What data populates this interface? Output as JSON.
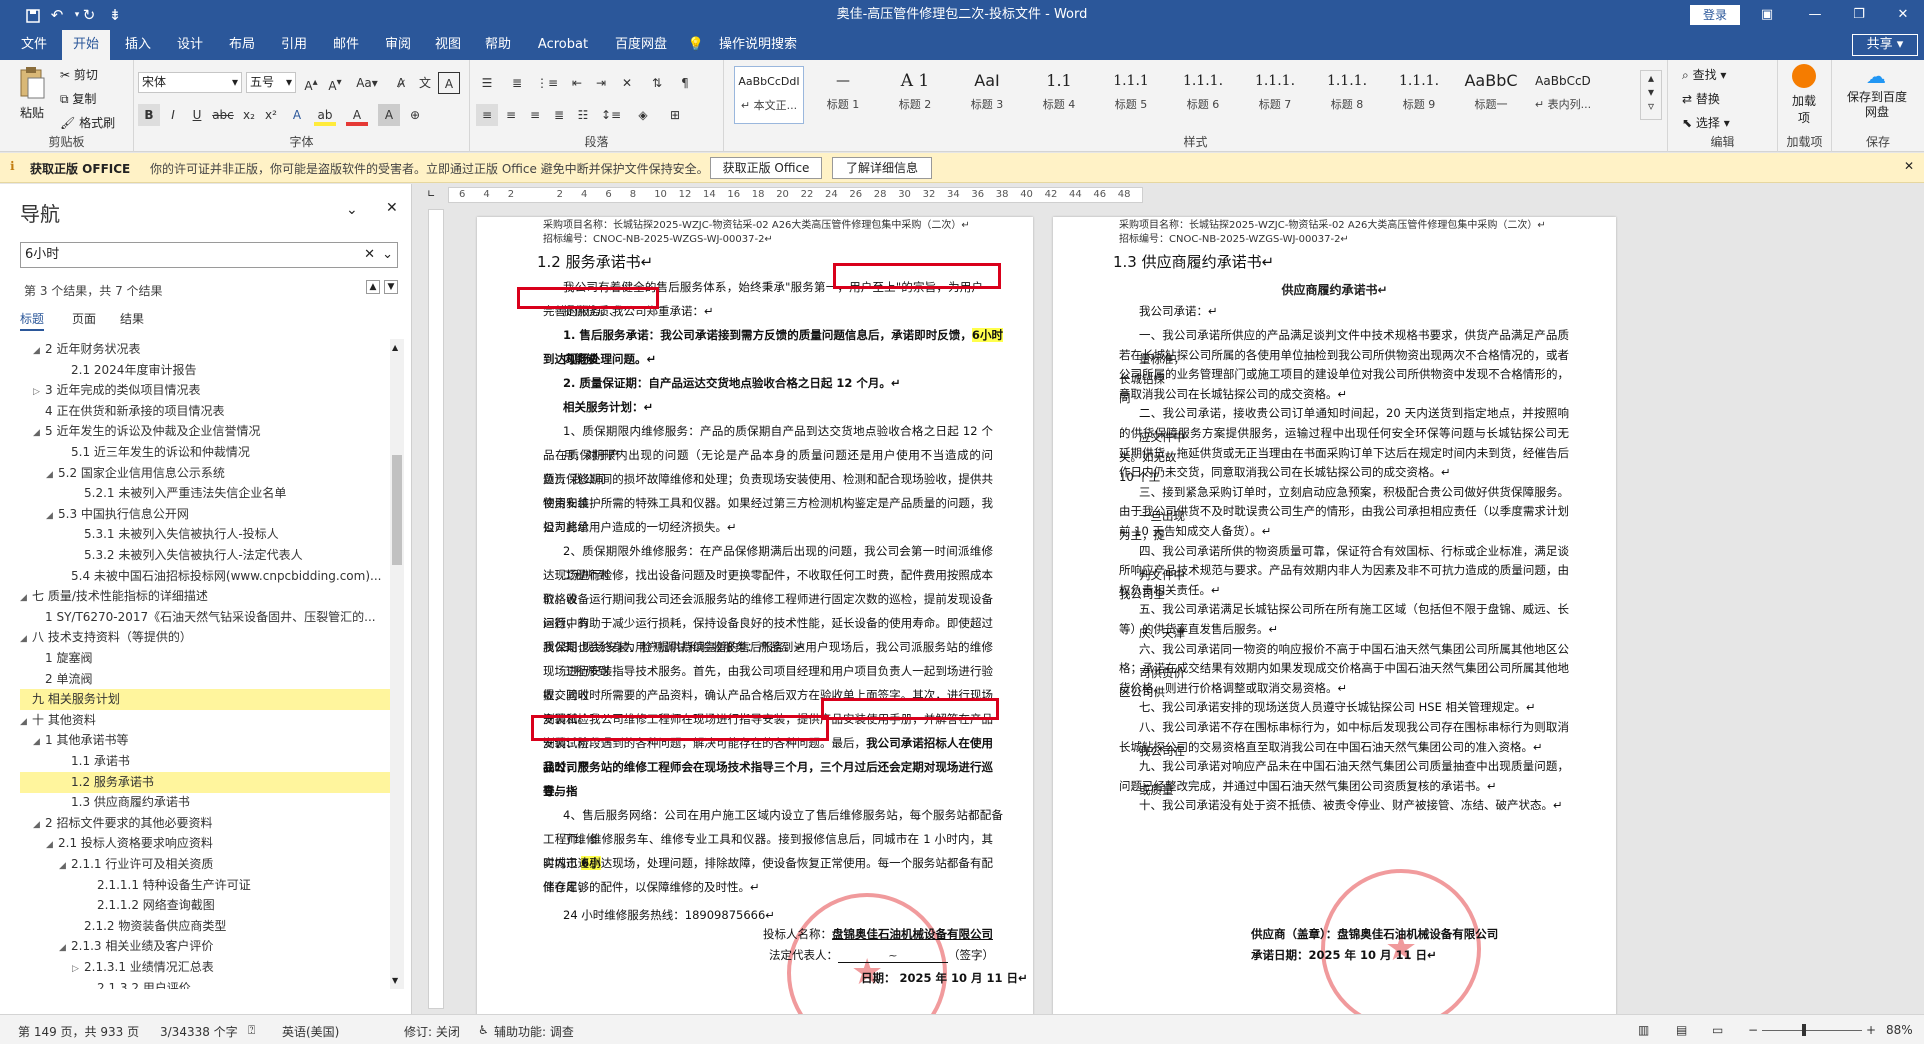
{
  "titlebar": {
    "title": "奥佳-高压管件修理包二次-投标文件 - Word",
    "login": "登录"
  },
  "menu": {
    "tabs": [
      "文件",
      "开始",
      "插入",
      "设计",
      "布局",
      "引用",
      "邮件",
      "审阅",
      "视图",
      "帮助",
      "Acrobat",
      "百度网盘",
      "操作说明搜索"
    ],
    "share": "共享"
  },
  "ribbon": {
    "clipboard": {
      "paste": "粘贴",
      "cut": "剪切",
      "copy": "复制",
      "format_painter": "格式刷",
      "label": "剪贴板"
    },
    "font": {
      "name": "宋体",
      "size": "五号",
      "label": "字体"
    },
    "paragraph": {
      "label": "段落"
    },
    "styles": {
      "label": "样式",
      "items": [
        {
          "preview": "AaBbCcDdI",
          "name": "↵ 本文正..."
        },
        {
          "preview": "—",
          "name": "标题 1"
        },
        {
          "preview": "A 1",
          "name": "标题 2"
        },
        {
          "preview": "AaI",
          "name": "标题 3"
        },
        {
          "preview": "1.1",
          "name": "标题 4"
        },
        {
          "preview": "1.1.1",
          "name": "标题 5"
        },
        {
          "preview": "1.1.1.",
          "name": "标题 6"
        },
        {
          "preview": "1.1.1.",
          "name": "标题 7"
        },
        {
          "preview": "1.1.1.",
          "name": "标题 8"
        },
        {
          "preview": "1.1.1.",
          "name": "标题 9"
        },
        {
          "preview": "AaBbC",
          "name": "标题一"
        },
        {
          "preview": "AaBbCcD",
          "name": "↵ 表内列..."
        }
      ]
    },
    "editing": {
      "find": "查找",
      "replace": "替换",
      "select": "选择",
      "label": "编辑"
    },
    "addins": {
      "load": "加载项",
      "label": "加载项"
    },
    "save": {
      "baidu": "保存到百度网盘",
      "label": "保存"
    }
  },
  "notice": {
    "title": "获取正版 OFFICE",
    "text": "你的许可证并非正版，你可能是盗版软件的受害者。立即通过正版 Office 避免中断并保护文件保持安全。",
    "btn1": "获取正版 Office",
    "btn2": "了解详细信息"
  },
  "nav": {
    "title": "导航",
    "search": "6小时",
    "result": "第 3 个结果，共 7 个结果",
    "tabs": [
      "标题",
      "页面",
      "结果"
    ],
    "items": [
      {
        "text": "2 近年财务状况表",
        "indent": 1,
        "tri": "◢"
      },
      {
        "text": "2.1 2024年度审计报告",
        "indent": 3,
        "tri": ""
      },
      {
        "text": "3 近年完成的类似项目情况表",
        "indent": 1,
        "tri": "▷"
      },
      {
        "text": "4 正在供货和新承接的项目情况表",
        "indent": 1,
        "tri": ""
      },
      {
        "text": "5 近年发生的诉讼及仲裁及企业信誉情况",
        "indent": 1,
        "tri": "◢"
      },
      {
        "text": "5.1 近三年发生的诉讼和仲裁情况",
        "indent": 3,
        "tri": ""
      },
      {
        "text": "5.2 国家企业信用信息公示系统",
        "indent": 2,
        "tri": "◢"
      },
      {
        "text": "5.2.1 未被列入严重违法失信企业名单",
        "indent": 4,
        "tri": ""
      },
      {
        "text": "5.3 中国执行信息公开网",
        "indent": 2,
        "tri": "◢"
      },
      {
        "text": "5.3.1 未被列入失信被执行人-投标人",
        "indent": 4,
        "tri": ""
      },
      {
        "text": "5.3.2 未被列入失信被执行人-法定代表人",
        "indent": 4,
        "tri": ""
      },
      {
        "text": "5.4 未被中国石油招标投标网(www.cnpcbidding.com)...",
        "indent": 3,
        "tri": ""
      },
      {
        "text": "七 质量/技术性能指标的详细描述",
        "indent": 0,
        "tri": "◢"
      },
      {
        "text": "1 SY/T6270-2017《石油天然气钻采设备固井、压裂管汇的...",
        "indent": 1,
        "tri": ""
      },
      {
        "text": "八 技术支持资料（等提供的）",
        "indent": 0,
        "tri": "◢"
      },
      {
        "text": "1 旋塞阀",
        "indent": 1,
        "tri": ""
      },
      {
        "text": "2 单流阀",
        "indent": 1,
        "tri": ""
      },
      {
        "text": "九 相关服务计划",
        "indent": 0,
        "tri": "",
        "hl": true
      },
      {
        "text": "十 其他资料",
        "indent": 0,
        "tri": "◢"
      },
      {
        "text": "1 其他承诺书等",
        "indent": 1,
        "tri": "◢"
      },
      {
        "text": "1.1 承诺书",
        "indent": 3,
        "tri": ""
      },
      {
        "text": "1.2 服务承诺书",
        "indent": 3,
        "tri": "",
        "hl": true
      },
      {
        "text": "1.3 供应商履约承诺书",
        "indent": 3,
        "tri": ""
      },
      {
        "text": "2 招标文件要求的其他必要资料",
        "indent": 1,
        "tri": "◢"
      },
      {
        "text": "2.1 投标人资格要求响应资料",
        "indent": 2,
        "tri": "◢"
      },
      {
        "text": "2.1.1 行业许可及相关资质",
        "indent": 3,
        "tri": "◢"
      },
      {
        "text": "2.1.1.1 特种设备生产许可证",
        "indent": 5,
        "tri": ""
      },
      {
        "text": "2.1.1.2 网络查询截图",
        "indent": 5,
        "tri": ""
      },
      {
        "text": "2.1.2 物资装备供应商类型",
        "indent": 4,
        "tri": ""
      },
      {
        "text": "2.1.3 相关业绩及客户评价",
        "indent": 3,
        "tri": "◢"
      },
      {
        "text": "2.1.3.1 业绩情况汇总表",
        "indent": 4,
        "tri": "▷"
      },
      {
        "text": "2.1.3.2 用户评价",
        "indent": 5,
        "tri": ""
      }
    ]
  },
  "ruler": [
    "6",
    "4",
    "2",
    "",
    "2",
    "4",
    "6",
    "8",
    "10",
    "12",
    "14",
    "16",
    "18",
    "20",
    "22",
    "24",
    "26",
    "28",
    "30",
    "32",
    "34",
    "36",
    "38",
    "40",
    "42",
    "44",
    "46",
    "48"
  ],
  "page1": {
    "hdr1": "采购项目名称：长城钻探2025-WZJC-物资钻采-02 A26大类高压管件修理包集中采购（二次）↵",
    "hdr2": "招标编号：CNOC-NB-2025-WZGS-WJ-00037-2↵",
    "title": "1.2 服务承诺书↵",
    "intro1": "我公司有着健全的售后服务体系，始终秉承\"服务第一，用户至上\"的宗旨，为用户提供优质、",
    "intro2": "完善的服务。我公司郑重承诺：↵",
    "p1a": "1. 售后服务承诺：我公司承诺接到需方反馈的质量问题信息后，承诺即时反馈，",
    "p1hl": "6小时",
    "p1b": "内能够",
    "p1c": "到达现场处理问题。↵",
    "p2": "2. 质量保证期：自产品运达交货地点验收合格之日起 12 个月。↵",
    "p3": "相关服务计划：↵",
    "s1": [
      "1、质保期限内维修服务：产品的质保期自产品到达交货地点验收合格之日起 12 个月，对于产",
      "品在质保期限内出现的问题（无论是产品本身的质量问题还是用户使用不当造成的问题），我公司",
      "负责保修期间的损坏故障维修和处理；负责现场安装使用、检测和配合现场验收，提供共物资安装",
      "使用和维护所需的特殊工具和仪器。如果经过第三方检测机构鉴定是产品质量的问题，我公司将承",
      "担为此给用户造成的一切经济损失。↵"
    ],
    "s2": [
      "2、质保期限外维修服务：在产品保修期满后出现的问题，我公司会第一时间派维修工程师到",
      "达现场进行检修，找出设备问题及时更换零配件，不收取任何工时费，配件费用按照成本价格收",
      "取。设备运行期间我公司还会派服务站的维修工程师进行固定次数的巡检，提前发现设备运行中的",
      "问题，有助于减少运行损耗，保持设备良好的技术性能，延长设备的使用寿命。即使超过质保期，",
      "我公司也会终身为用户提供持续完善的售后服务。↵"
    ],
    "s3": [
      "3、现场安装、检测调试和验收服务：产品到达用户现场后，我公司派服务站的维修工程师到",
      "现场进行安装指导技术服务。首先，由我公司项目经理和用户项目负责人一起到场进行验收，同时",
      "提交验收时所需要的产品资料，确认产品合格后双方在验收单上面签字。其次，进行现场安装和检",
      "测调试。我公司维修工程师在现场进行指导安装，提供产品安装使用手册，并解答在产品安装、检",
      "测调试阶段遇到的各种问题，解决可能存在的各种问题。最后，我公司承诺招标人在使用我公司产",
      "品时，服务站的维修工程师会在现场技术指导三个月，三个月过后还会定期对现场进行巡查与指",
      "导。↵"
    ],
    "s4a": "4、售后服务网络：公司在用户施工区域内设立了售后维修服务站，每个服务站都配备了维修",
    "s4b": "工程师、维修服务车、维修专业工具和仪器。接到报修信息后，同城市在 1 小时内，其实城市",
    "s4hl": "6小",
    "s4c": "时内迅速到达现场，处理问题，排除故障，使设备恢复正常使用。每一个服务站都备有配件仓库，",
    "s4d": "储存足够的配件，以保障维修的及时性。↵",
    "hotline": "24 小时维修服务热线：18909875666↵",
    "bidder_label": "投标人名称：",
    "bidder": "盘锦奥佳石油机械设备有限公司",
    "legal_label": "法定代表人：",
    "legal_sign": "（签字）",
    "date": "日期： 2025 年 10 月 11 日↵"
  },
  "page2": {
    "hdr1": "采购项目名称：长城钻探2025-WZJC-物资钻采-02 A26大类高压管件修理包集中采购（二次）↵",
    "hdr2": "招标编号：CNOC-NB-2025-WZGS-WJ-00037-2↵",
    "title": "1.3 供应商履约承诺书↵",
    "center": "供应商履约承诺书↵",
    "greet": "我公司承诺：↵",
    "lines": [
      "一、我公司承诺所供应的产品满足谈判文件中技术规格书要求，供货产品满足产品质量标准，",
      "若在长城钻探公司所属的各使用单位抽检到我公司所供物资出现两次不合格情况的，或者长城钻探",
      "公司所属的业务管理部门或施工项目的建设单位对我公司所供物资中发现不合格情形的，同",
      "意取消我公司在长城钻探公司的成交资格。↵",
      "二、我公司承诺，接收贵公司订单通知时间起，20 天内送货到指定地点，并按照响应文件中",
      "的供货保障服务方案提供服务，运输过程中出现任何安全环保等问题与长城钻探公司无关。如无故",
      "延期供货、拖延供货或无正当理由在书面采购订单下达后在规定时间内未到货，经催告后 10 个工",
      "作日内仍未交货，同意取消我公司在长城钻探公司的成交资格。↵",
      "三、接到紧急采购订单时，立刻启动应急预案，积极配合贵公司做好供货保障服务。一旦出现",
      "由于我公司供货不及时耽误贵公司生产的情形，由我公司承担相应责任（以季度需求计划为主，提",
      "前 10 天告知成交人备货）。↵",
      "四、我公司承诺所供的物资质量可靠，保证符合有效国标、行标或企业标准，满足谈判文件中",
      "所响应产品技术规范与要求。产品有效期内非人为因素及非不可抗力造成的质量问题，由我公司全",
      "权负责相关责任。↵",
      "五、我公司承诺满足长城钻探公司所在所有施工区域（包括但不限于盘锦、威远、长庆、天津",
      "等）的供货率直发售后服务。↵",
      "六、我公司承诺同一物资的响应报价不高于中国石油天然气集团公司所属其他地区公司供货价",
      "格；承诺在成交结果有效期内如果发现成交价格高于中国石油天然气集团公司所属其他地区公司供",
      "货价格，则进行价格调整或取消交易资格。↵",
      "七、我公司承诺安排的现场送货人员遵守长城钻探公司 HSE 相关管理规定。↵",
      "八、我公司承诺不存在围标串标行为，如中标后发现我公司存在围标串标行为则取消我公司在",
      "长城钻探公司的交易资格直至取消我公司在中国石油天然气集团公司的准入资格。↵",
      "九、我公司承诺对响应产品未在中国石油天然气集团公司质量抽查中出现质量问题，或质量",
      "问题已经整改完成，并通过中国石油天然气集团公司资质复核的承诺书。↵",
      "十、我公司承诺没有处于资不抵债、被责令停业、财产被接管、冻结、破产状态。↵"
    ],
    "supplier_label": "供应商（盖章）：",
    "supplier": "盘锦奥佳石油机械设备有限公司",
    "date": "承诺日期：2025 年 10 月 11 日↵"
  },
  "status": {
    "page": "第 149 页，共 933 页",
    "words": "3/34338 个字",
    "lang": "英语(美国)",
    "revise": "修订: 关闭",
    "access": "辅助功能: 调查",
    "zoom": "88%"
  }
}
